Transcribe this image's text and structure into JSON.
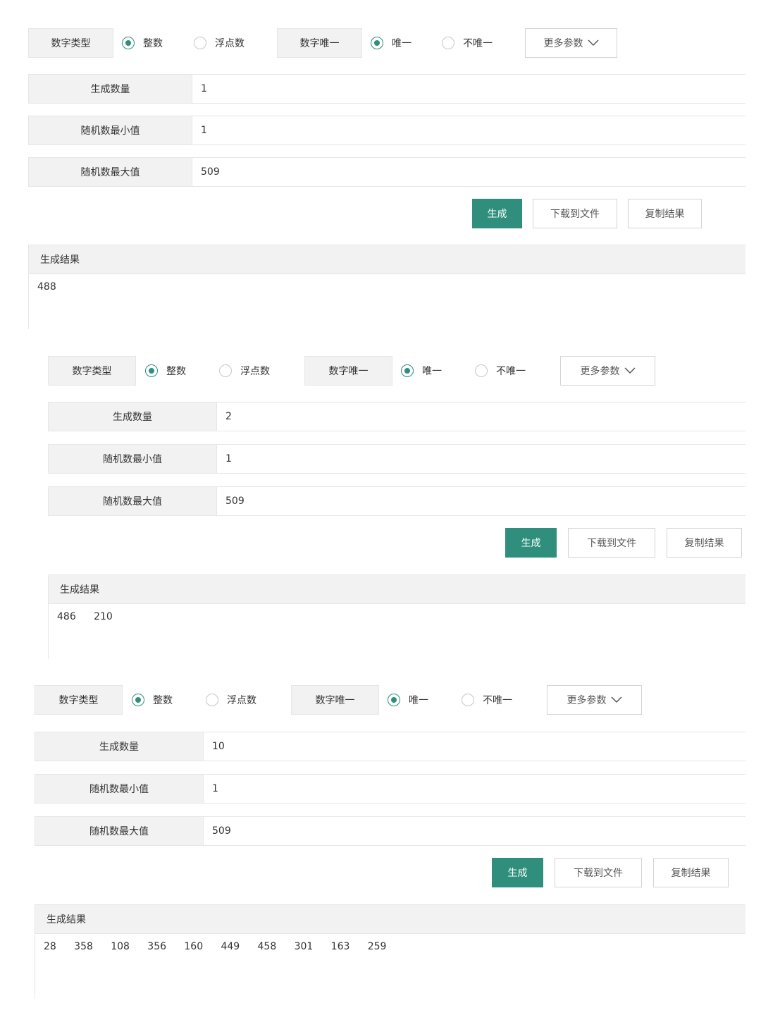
{
  "labels": {
    "number_type": "数字类型",
    "integer": "整数",
    "float": "浮点数",
    "number_unique": "数字唯一",
    "unique": "唯一",
    "not_unique": "不唯一",
    "more_params": "更多参数",
    "generate_count": "生成数量",
    "random_min": "随机数最小值",
    "random_max": "随机数最大值",
    "generate": "生成",
    "download_to_file": "下载到文件",
    "copy_result": "复制结果",
    "generate_result": "生成结果"
  },
  "colors": {
    "accent": "#2f8f7c",
    "label_bg": "#f2f2f2",
    "border": "#e6e6e6"
  },
  "panels": [
    {
      "number_type_selected": "整数",
      "number_unique_selected": "唯一",
      "count": "1",
      "min": "1",
      "max": "509",
      "result": "488"
    },
    {
      "number_type_selected": "整数",
      "number_unique_selected": "唯一",
      "count": "2",
      "min": "1",
      "max": "509",
      "result": "486   210"
    },
    {
      "number_type_selected": "整数",
      "number_unique_selected": "唯一",
      "count": "10",
      "min": "1",
      "max": "509",
      "result": "28   358   108   356   160   449   458   301   163   259"
    }
  ]
}
